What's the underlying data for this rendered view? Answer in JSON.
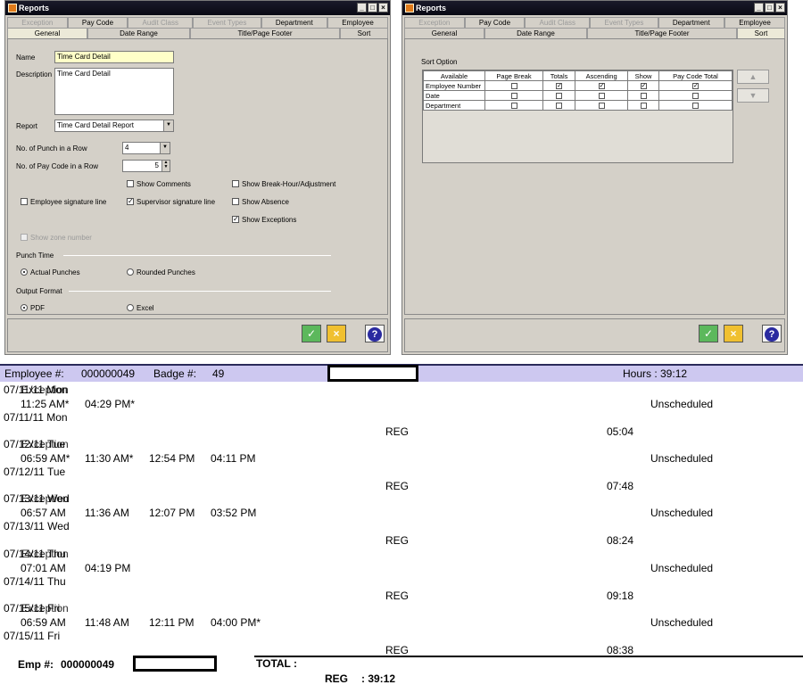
{
  "left_window": {
    "title": "Reports",
    "tabs_row1": [
      {
        "label": "Exception",
        "disabled": true
      },
      {
        "label": "Pay Code",
        "disabled": false
      },
      {
        "label": "Audit Class",
        "disabled": true
      },
      {
        "label": "Event Types",
        "disabled": true
      },
      {
        "label": "Department",
        "disabled": false
      },
      {
        "label": "Employee",
        "disabled": false
      }
    ],
    "tabs_row2": [
      "General",
      "Date Range",
      "Title/Page Footer",
      "Sort"
    ],
    "active_tab": "General",
    "name_label": "Name",
    "name_value": "Time Card Detail",
    "description_label": "Description",
    "description_value": "Time Card Detail",
    "report_label": "Report",
    "report_value": "Time Card Detail Report",
    "punch_in_row_label": "No. of Punch in a Row",
    "punch_in_row_value": "4",
    "pay_code_in_row_label": "No. of Pay Code in a Row",
    "pay_code_in_row_value": "5",
    "show_comments": "Show Comments",
    "show_break": "Show Break-Hour/Adjustment",
    "employee_signature": "Employee signature line",
    "supervisor_signature": "Supervisor signature line",
    "show_absence": "Show Absence",
    "show_exceptions": "Show Exceptions",
    "show_zone_number": "Show zone number",
    "punch_time_label": "Punch Time",
    "actual_punches": "Actual Punches",
    "rounded_punches": "Rounded Punches",
    "output_format_label": "Output Format",
    "pdf": "PDF",
    "excel": "Excel",
    "check_mark": "✓",
    "window_buttons": {
      "min": "_",
      "max": "□",
      "close": "×"
    },
    "ok_icon": "✓",
    "cancel_icon": "×",
    "help_icon": "?"
  },
  "right_window": {
    "title": "Reports",
    "tabs_row1": [
      {
        "label": "Exception",
        "disabled": true
      },
      {
        "label": "Pay Code",
        "disabled": false
      },
      {
        "label": "Audit Class",
        "disabled": true
      },
      {
        "label": "Event Types",
        "disabled": true
      },
      {
        "label": "Department",
        "disabled": false
      },
      {
        "label": "Employee",
        "disabled": false
      }
    ],
    "tabs_row2": [
      "General",
      "Date Range",
      "Title/Page Footer",
      "Sort"
    ],
    "active_tab": "Sort",
    "sort_option_label": "Sort Option",
    "columns": [
      "Available",
      "Page Break",
      "Totals",
      "Ascending",
      "Show",
      "Pay Code Total"
    ],
    "rows": [
      {
        "name": "Employee Number",
        "checks": [
          false,
          true,
          true,
          true,
          true
        ]
      },
      {
        "name": "Date",
        "checks": [
          false,
          false,
          false,
          false,
          false
        ]
      },
      {
        "name": "Department",
        "checks": [
          false,
          false,
          false,
          false,
          false
        ]
      }
    ],
    "up_arrow": "▲",
    "down_arrow": "▼"
  },
  "report": {
    "employee_label": "Employee #:",
    "employee_number": "000000049",
    "badge_label": "Badge #:",
    "badge_number": "49",
    "hours_label": "Hours : 39:12",
    "days": [
      {
        "overlap": "07/11/11 Mon",
        "overlap2": "Exception",
        "punches": [
          "11:25 AM*",
          "04:29 PM*"
        ],
        "status": "Unscheduled",
        "date": "07/11/11 Mon",
        "code": "REG",
        "hours": "05:04"
      },
      {
        "overlap": "07/12/11 Tue",
        "overlap2": "Exception",
        "punches": [
          "06:59 AM*",
          "11:30 AM*",
          "12:54 PM",
          "04:11 PM"
        ],
        "status": "Unscheduled",
        "date": "07/12/11  Tue",
        "code": "REG",
        "hours": "07:48"
      },
      {
        "overlap": "07/13/11 Wed",
        "overlap2": "Exception",
        "punches": [
          "06:57 AM",
          "11:36 AM",
          "12:07 PM",
          "03:52 PM"
        ],
        "status": "Unscheduled",
        "date": "07/13/11  Wed",
        "code": "REG",
        "hours": "08:24"
      },
      {
        "overlap": "07/14/11 Thu",
        "overlap2": "Exception",
        "punches": [
          "07:01 AM",
          "04:19 PM"
        ],
        "status": "Unscheduled",
        "date": "07/14/11  Thu",
        "code": "REG",
        "hours": "09:18"
      },
      {
        "overlap": "07/15/11 Fri",
        "overlap2": "Exception",
        "punches": [
          "06:59 AM",
          "11:48 AM",
          "12:11 PM",
          "04:00 PM*"
        ],
        "status": "Unscheduled",
        "date": "07/15/11  Fri",
        "code": "REG",
        "hours": "08:38"
      }
    ],
    "emp_footer_label": "Emp #:",
    "emp_footer_number": "000000049",
    "total_label": "TOTAL :",
    "total_code": "REG",
    "total_value": ": 39:12"
  }
}
